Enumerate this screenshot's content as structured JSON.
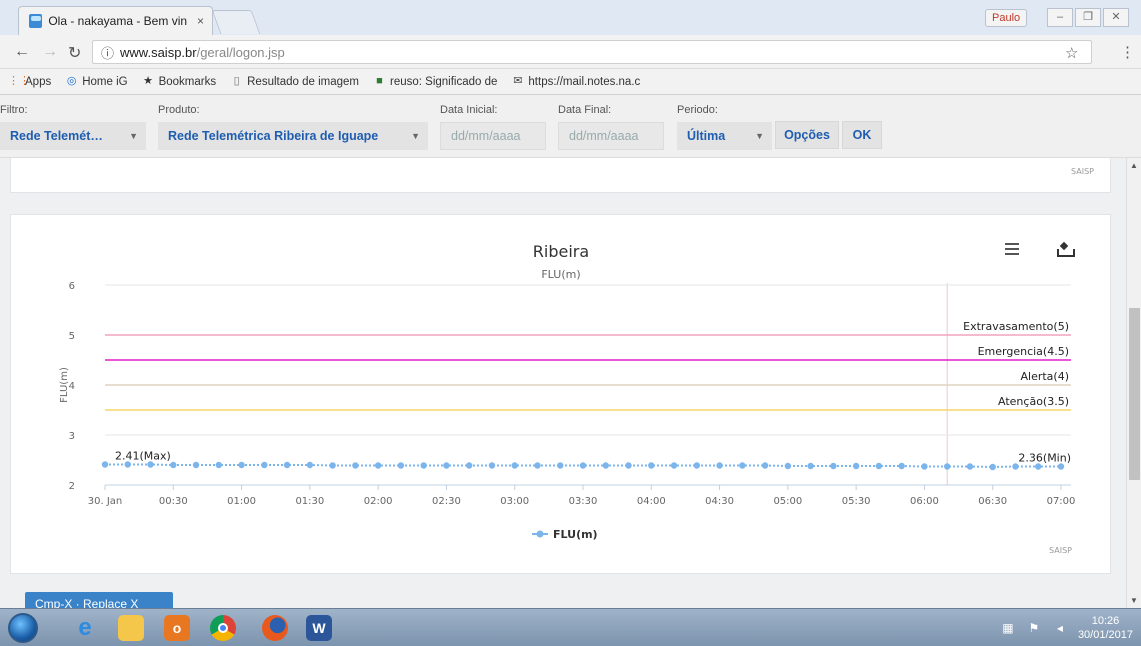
{
  "browser": {
    "tab_title": "Ola - nakayama - Bem vin",
    "tab_close": "×",
    "user_badge": "Paulo",
    "url_host": "www.saisp.br",
    "url_path": "/geral/logon.jsp",
    "icons": {
      "back": "back-arrow-icon",
      "forward": "forward-arrow-icon",
      "reload": "reload-icon",
      "info": "info-icon",
      "star": "star-icon",
      "menu": "kebab-menu-icon"
    }
  },
  "bookmarks": [
    {
      "label": "Apps",
      "icon": "apps-grid-icon"
    },
    {
      "label": "Home iG",
      "icon": "ig-icon"
    },
    {
      "label": "Bookmarks",
      "icon": "star-icon"
    },
    {
      "label": "Resultado de imagem",
      "icon": "page-icon"
    },
    {
      "label": "reuso: Significado de",
      "icon": "dicio-icon"
    },
    {
      "label": "https://mail.notes.na.c",
      "icon": "mail-icon"
    }
  ],
  "filters": {
    "filtro": {
      "label": "Filtro:",
      "value": "Rede Telemét…"
    },
    "produto": {
      "label": "Produto:",
      "value": "Rede Telemétrica Ribeira de Iguape"
    },
    "data_inicial": {
      "label": "Data Inicial:",
      "placeholder": "dd/mm/aaaa"
    },
    "data_final": {
      "label": "Data Final:",
      "placeholder": "dd/mm/aaaa"
    },
    "periodo": {
      "label": "Periodo:",
      "value": "Última"
    },
    "opcoes_label": "Opções",
    "ok_label": "OK"
  },
  "top_card": {
    "credit": "SAISP"
  },
  "chart_data": {
    "type": "line",
    "title": "Ribeira",
    "subtitle": "FLU(m)",
    "ylabel": "FLU(m)",
    "xlabel": "",
    "ylim": [
      2,
      6
    ],
    "yticks": [
      "2",
      "3",
      "4",
      "5",
      "6"
    ],
    "xticks": [
      "30. Jan",
      "00:30",
      "01:00",
      "01:30",
      "02:00",
      "02:30",
      "03:00",
      "03:30",
      "04:00",
      "04:30",
      "05:00",
      "05:30",
      "06:00",
      "06:30",
      "07:00"
    ],
    "x_range_minutes": [
      0,
      420
    ],
    "series": [
      {
        "name": "FLU(m)",
        "color": "#7cb5ec",
        "x_minutes": [
          0,
          10,
          20,
          30,
          40,
          50,
          60,
          70,
          80,
          90,
          100,
          110,
          120,
          130,
          140,
          150,
          160,
          170,
          180,
          190,
          200,
          210,
          220,
          230,
          240,
          250,
          260,
          270,
          280,
          290,
          300,
          310,
          320,
          330,
          340,
          350,
          360,
          370,
          380,
          390,
          400,
          410,
          420
        ],
        "values": [
          2.41,
          2.41,
          2.41,
          2.4,
          2.4,
          2.4,
          2.4,
          2.4,
          2.4,
          2.4,
          2.39,
          2.39,
          2.39,
          2.39,
          2.39,
          2.39,
          2.39,
          2.39,
          2.39,
          2.39,
          2.39,
          2.39,
          2.39,
          2.39,
          2.39,
          2.39,
          2.39,
          2.39,
          2.39,
          2.39,
          2.38,
          2.38,
          2.38,
          2.38,
          2.38,
          2.38,
          2.37,
          2.37,
          2.37,
          2.36,
          2.37,
          2.37,
          2.37
        ]
      }
    ],
    "thresholds": [
      {
        "label": "Extravasamento(5)",
        "value": 5,
        "color": "#f2a3bd"
      },
      {
        "label": "Emergencia(4.5)",
        "value": 4.5,
        "color": "#e31ec7"
      },
      {
        "label": "Alerta(4)",
        "value": 4,
        "color": "#e0d4c0"
      },
      {
        "label": "Atenção(3.5)",
        "value": 3.5,
        "color": "#f5d66a"
      }
    ],
    "plot_band_from_minutes": 370,
    "annotations": [
      {
        "label": "2.41(Max)"
      },
      {
        "label": "2.36(Min)"
      }
    ],
    "legend": {
      "label": "FLU(m)",
      "position": "bottom-center"
    },
    "credit": "SAISP",
    "grid": true
  },
  "chart_menu": {
    "menu_icon": "hamburger-icon",
    "download_icon": "download-icon"
  },
  "bottom_button_label": "Cmp-X · Replace X",
  "taskbar": {
    "start_icon": "windows-start-icon",
    "apps": [
      "ie-icon",
      "file-explorer-icon",
      "outlook-icon",
      "chrome-icon",
      "firefox-icon",
      "word-icon"
    ],
    "time": "10:26",
    "date": "30/01/2017"
  }
}
